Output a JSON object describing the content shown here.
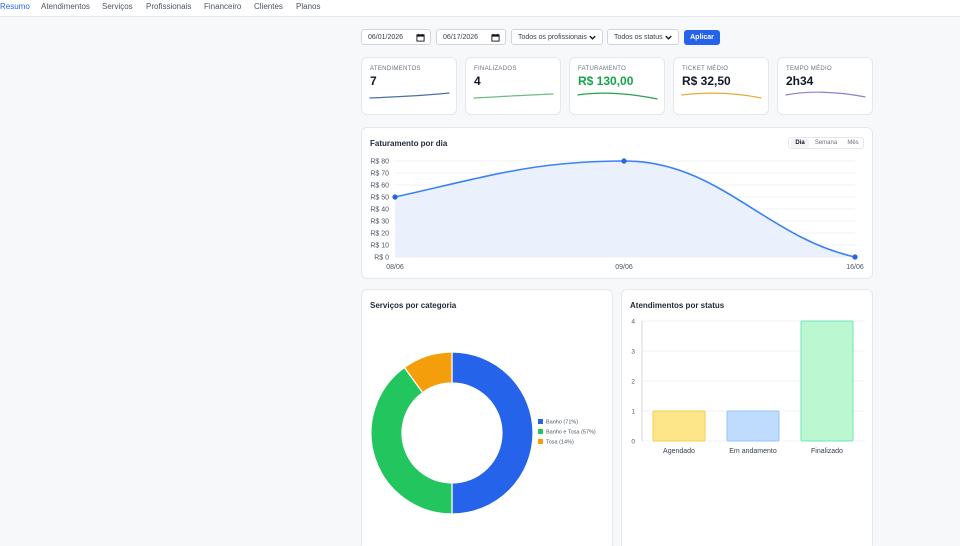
{
  "nav": {
    "items": [
      "Resumo",
      "Atendimentos",
      "Serviços",
      "Profissionais",
      "Financeiro",
      "Clientes",
      "Planos"
    ],
    "active": "Resumo"
  },
  "filters": {
    "date_from": "06/01/2026",
    "date_to": "06/17/2026",
    "professional": "Todos os profissionais",
    "status": "Todos os status",
    "apply_label": "Aplicar"
  },
  "kpis": [
    {
      "label": "ATENDIMENTOS",
      "value": "7",
      "color": "#4b6ea9"
    },
    {
      "label": "FINALIZADOS",
      "value": "4",
      "color": "#6dbb82"
    },
    {
      "label": "FATURAMENTO",
      "value": "R$ 130,00",
      "color": "#22a34a"
    },
    {
      "label": "TICKET MÉDIO",
      "value": "R$ 32,50",
      "color": "#e8a93a"
    },
    {
      "label": "TEMPO MÉDIO",
      "value": "2h34",
      "color": "#8b7fd0"
    }
  ],
  "revenue": {
    "title": "Faturamento por dia",
    "tabs": [
      "Dia",
      "Semana",
      "Mês"
    ],
    "active_tab": "Dia"
  },
  "categories": {
    "title": "Serviços por categoria"
  },
  "status_panel": {
    "title": "Atendimentos por status"
  },
  "colors": {
    "primary": "#2563eb",
    "line": "#3b82f6",
    "green": "#22c55e",
    "orange": "#f59e0b"
  },
  "chart_data": [
    {
      "type": "line",
      "title": "Faturamento por dia",
      "x": [
        "08/06",
        "09/06",
        "16/06"
      ],
      "series": [
        {
          "values": [
            50,
            80,
            0
          ]
        }
      ],
      "y_ticks": [
        "R$ 0",
        "R$ 10",
        "R$ 20",
        "R$ 30",
        "R$ 40",
        "R$ 50",
        "R$ 60",
        "R$ 70",
        "R$ 80"
      ],
      "ylim": [
        0,
        80
      ],
      "grid": true
    },
    {
      "type": "pie",
      "title": "Serviços por categoria",
      "slices": [
        {
          "name": "Banho (71%)",
          "value": 50,
          "color": "#2563eb"
        },
        {
          "name": "Banho e Tosa (57%)",
          "value": 40,
          "color": "#22c55e"
        },
        {
          "name": "Tosa (14%)",
          "value": 10,
          "color": "#f59e0b"
        }
      ],
      "legend": "right"
    },
    {
      "type": "bar",
      "title": "Atendimentos por status",
      "categories": [
        "Agendado",
        "Em andamento",
        "Finalizado"
      ],
      "values": [
        1,
        1,
        4
      ],
      "colors": [
        "#fde68a",
        "#bfdbfe",
        "#bbf7d0"
      ],
      "borders": [
        "#f5cd4b",
        "#93c5fd",
        "#6ee7b7"
      ],
      "ylim": [
        0,
        4
      ],
      "y_ticks": [
        "0",
        "1",
        "2",
        "3",
        "4"
      ]
    }
  ]
}
